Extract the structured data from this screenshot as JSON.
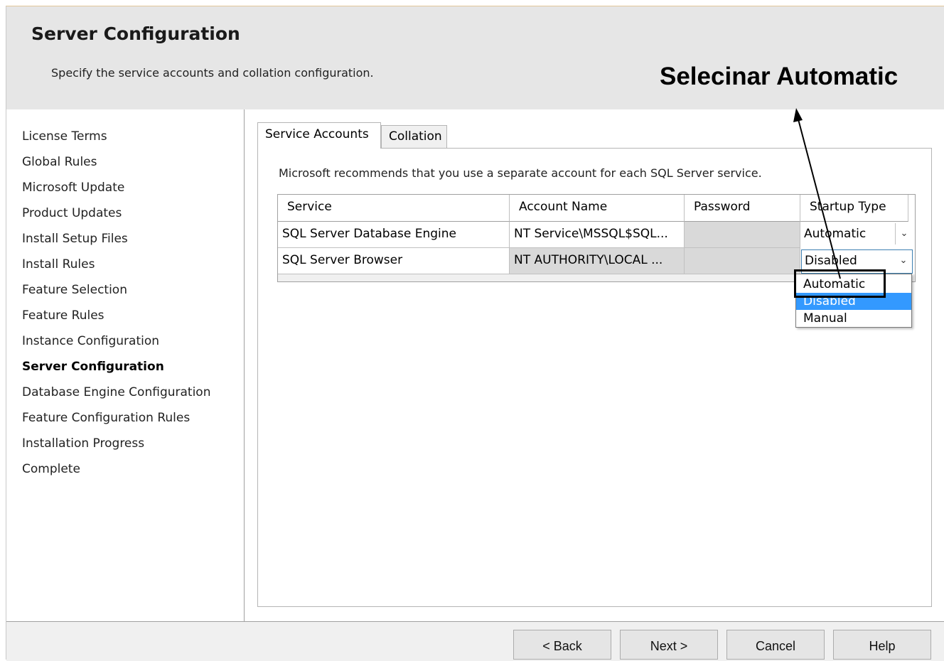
{
  "header": {
    "title": "Server Configuration",
    "subtitle": "Specify the service accounts and collation configuration."
  },
  "annotation": {
    "text": "Selecinar Automatic"
  },
  "sidebar": {
    "items": [
      {
        "label": "License Terms"
      },
      {
        "label": "Global Rules"
      },
      {
        "label": "Microsoft Update"
      },
      {
        "label": "Product Updates"
      },
      {
        "label": "Install Setup Files"
      },
      {
        "label": "Install Rules"
      },
      {
        "label": "Feature Selection"
      },
      {
        "label": "Feature Rules"
      },
      {
        "label": "Instance Configuration"
      },
      {
        "label": "Server Configuration",
        "active": true
      },
      {
        "label": "Database Engine Configuration"
      },
      {
        "label": "Feature Configuration Rules"
      },
      {
        "label": "Installation Progress"
      },
      {
        "label": "Complete"
      }
    ]
  },
  "tabs": [
    {
      "label": "Service Accounts",
      "active": true
    },
    {
      "label": "Collation",
      "active": false
    }
  ],
  "service_accounts": {
    "recommendation": "Microsoft recommends that you use a separate account for each SQL Server service.",
    "columns": [
      "Service",
      "Account Name",
      "Password",
      "Startup Type"
    ],
    "rows": [
      {
        "service": "SQL Server Database Engine",
        "account": "NT Service\\MSSQL$SQL...",
        "password": "",
        "startup": "Automatic"
      },
      {
        "service": "SQL Server Browser",
        "account": "NT AUTHORITY\\LOCAL ...",
        "password": "",
        "startup": "Disabled"
      }
    ],
    "dropdown": {
      "options": [
        "Automatic",
        "Disabled",
        "Manual"
      ],
      "highlighted": "Disabled"
    }
  },
  "footer": {
    "back": "< Back",
    "next": "Next >",
    "cancel": "Cancel",
    "help": "Help"
  },
  "icons": {
    "combo_arrow": "chevron-down-icon"
  },
  "colors": {
    "selection": "#3399ff",
    "header_bg": "#e6e6e6"
  }
}
